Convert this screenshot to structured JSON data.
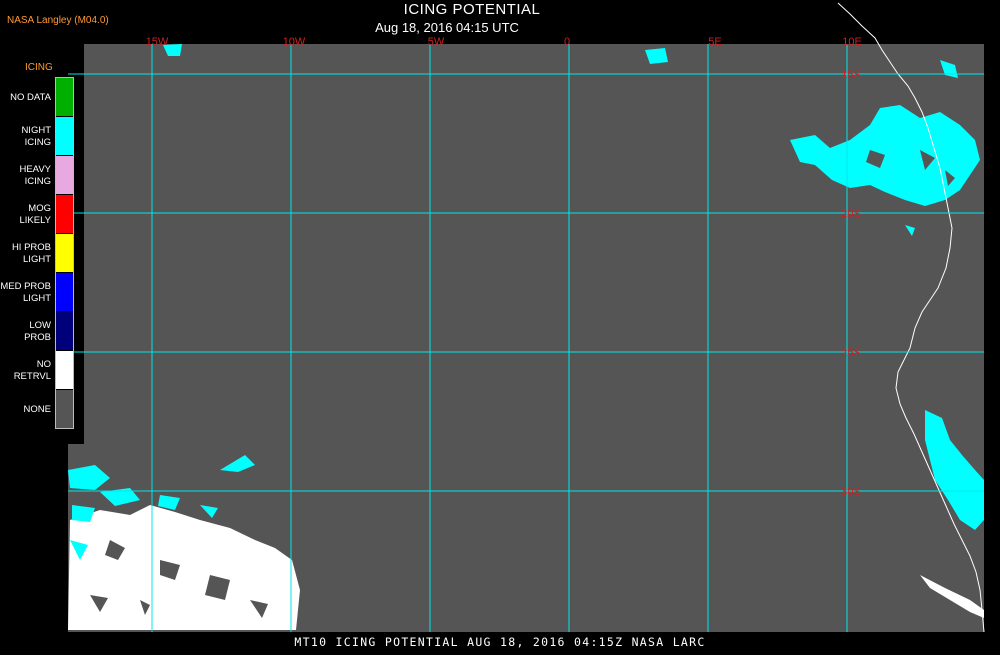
{
  "header": {
    "source": "NASA Langley (M04.0)",
    "title": "ICING POTENTIAL",
    "subtitle": "Aug 18, 2016 04:15 UTC"
  },
  "legend": {
    "title": "ICING",
    "items": [
      {
        "lines": [
          "NO DATA"
        ],
        "color": "#00b000"
      },
      {
        "lines": [
          "NIGHT",
          "ICING"
        ],
        "color": "#00ffff"
      },
      {
        "lines": [
          "HEAVY",
          "ICING"
        ],
        "color": "#e8a8e0"
      },
      {
        "lines": [
          "MOG",
          "LIKELY"
        ],
        "color": "#ff0000"
      },
      {
        "lines": [
          "HI PROB",
          "LIGHT"
        ],
        "color": "#ffff00"
      },
      {
        "lines": [
          "MED PROB",
          "LIGHT"
        ],
        "color": "#0000ff"
      },
      {
        "lines": [
          "LOW",
          "PROB"
        ],
        "color": "#00007a"
      },
      {
        "lines": [
          "NO",
          "RETRVL"
        ],
        "color": "#ffffff"
      },
      {
        "lines": [
          "NONE"
        ],
        "color": "#555555"
      }
    ]
  },
  "map": {
    "background_color": "#555555",
    "grid_color": "#00e8e8",
    "grid_label_color": "#cc2222",
    "coastline_color": "#ffffff",
    "lon_labels": [
      "15W",
      "10W",
      "5W",
      "0",
      "5E",
      "10E"
    ],
    "lat_labels": [
      "15S",
      "20S",
      "25S",
      "30S"
    ]
  },
  "footer": {
    "text": "MT10  ICING POTENTIAL  AUG 18, 2016 04:15Z  NASA LARC"
  }
}
